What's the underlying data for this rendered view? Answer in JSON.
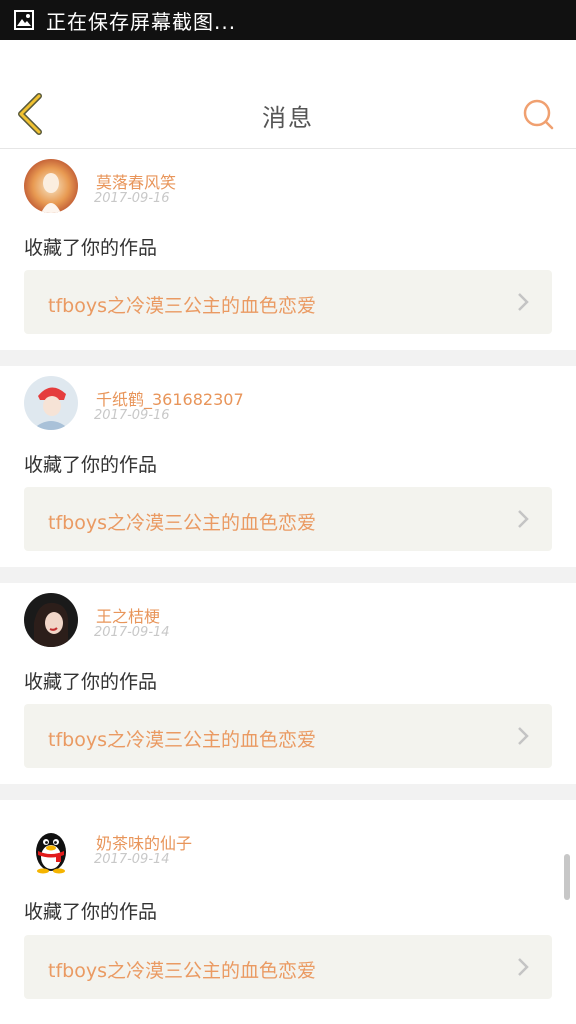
{
  "status_bar": {
    "text": "正在保存屏幕截图...",
    "icon": "image-icon"
  },
  "header": {
    "title": "消息",
    "back_icon": "chevron-left-icon",
    "search_icon": "search-icon",
    "accent_color": "#e8955a"
  },
  "messages": [
    {
      "username": "莫落春风笑",
      "date": "2017-09-16",
      "action": "收藏了你的作品",
      "work_title": "tfboys之冷漠三公主的血色恋爱"
    },
    {
      "username": "千纸鹤_361682307",
      "date": "2017-09-16",
      "action": "收藏了你的作品",
      "work_title": "tfboys之冷漠三公主的血色恋爱"
    },
    {
      "username": "王之桔梗",
      "date": "2017-09-14",
      "action": "收藏了你的作品",
      "work_title": "tfboys之冷漠三公主的血色恋爱"
    },
    {
      "username": "奶茶味的仙子",
      "date": "2017-09-14",
      "action": "收藏了你的作品",
      "work_title": "tfboys之冷漠三公主的血色恋爱"
    }
  ]
}
